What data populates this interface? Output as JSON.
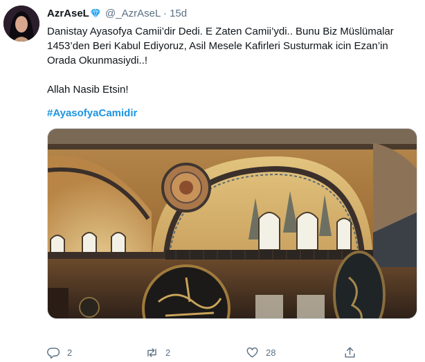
{
  "author": {
    "name": "AzrAseL",
    "handle": "@_AzrAseL",
    "separator": "·",
    "time": "15d"
  },
  "tweet": {
    "lines": [
      "Danistay Ayasofya Camii’dir Dedi. E Zaten Camii’ydi.. Bunu Biz Müslümalar",
      "1453’den Beri Kabul Ediyoruz, Asil Mesele Kafirleri Susturmak icin Ezan’in",
      "Orada Okunmasiydi..!"
    ],
    "line2": "Allah Nasib Etsin!",
    "hashtag": "#AyasofyaCamidir"
  },
  "actions": {
    "reply_count": "2",
    "retweet_count": "2",
    "like_count": "28"
  },
  "colors": {
    "hashtag": "#1b95e0",
    "meta": "#5b7083",
    "verified": "#1da1f2"
  },
  "icons": [
    "verified-diamond-icon",
    "reply-icon",
    "retweet-icon",
    "like-icon",
    "share-icon"
  ]
}
